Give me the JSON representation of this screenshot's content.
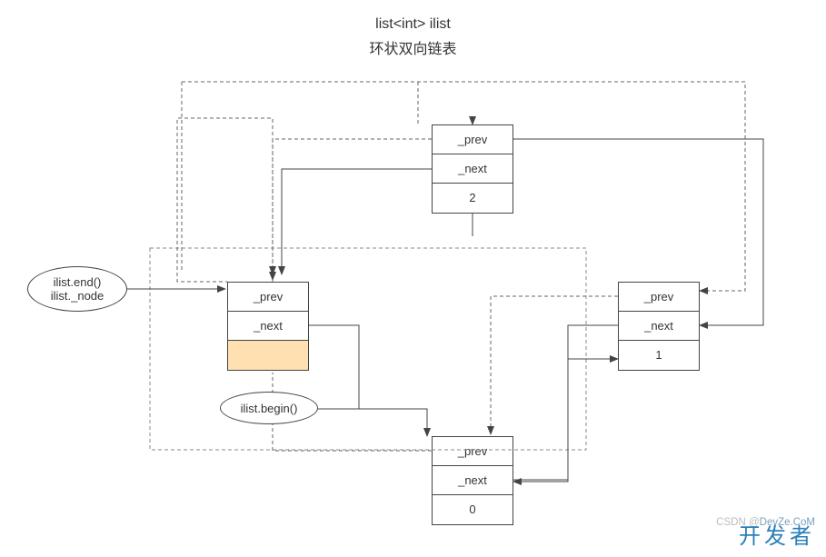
{
  "title": {
    "line1": "list<int> ilist",
    "line2": "环状双向链表"
  },
  "nodes": {
    "top": {
      "prev": "_prev",
      "next": "_next",
      "data": "2"
    },
    "sentinel": {
      "prev": "_prev",
      "next": "_next",
      "data": ""
    },
    "right": {
      "prev": "_prev",
      "next": "_next",
      "data": "1"
    },
    "bottom": {
      "prev": "_prev",
      "next": "_next",
      "data": "0"
    }
  },
  "labels": {
    "end": "ilist.end()",
    "node": "ilist._node",
    "begin": "ilist.begin()"
  },
  "watermark": {
    "csdn_prefix": "CSDN @",
    "csdn_handle": "DevZe.CoM",
    "brand": "开发者"
  }
}
